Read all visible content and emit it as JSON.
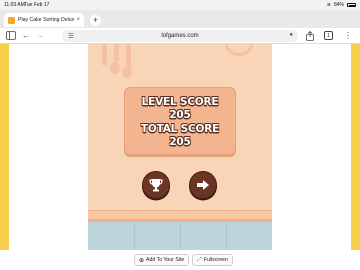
{
  "status_bar": {
    "time": "11:03 AM",
    "date": "Tue Feb 17",
    "battery": "84%"
  },
  "browser": {
    "tab_title": "Play Cake Sorting Delux",
    "url": "lofgames.com",
    "tab_count": "1"
  },
  "game": {
    "level_score_label": "LEVEL SCORE",
    "level_score": "205",
    "total_score_label": "TOTAL SCORE",
    "total_score": "205"
  },
  "footer": {
    "add_label": "Add To Your Site",
    "fullscreen_label": "Fullscreen"
  },
  "colors": {
    "page_side": "#f6d04a",
    "game_bg": "#f9d5b8",
    "panel_bg": "#f3b490",
    "button_bg": "#6b3425"
  }
}
